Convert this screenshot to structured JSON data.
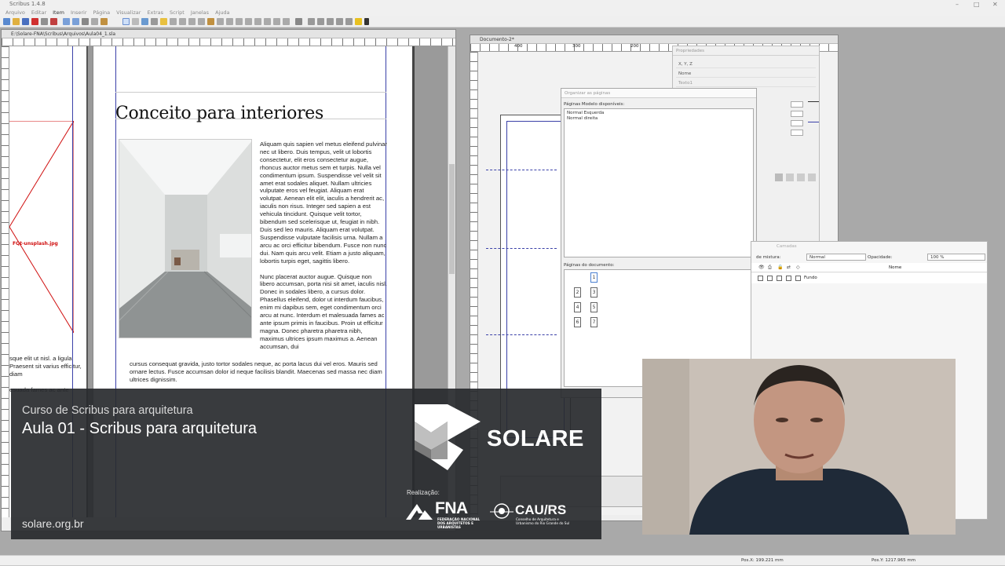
{
  "app": {
    "title": "Scribus 1.4.8",
    "menu": [
      "Arquivo",
      "Editar",
      "Item",
      "Inserir",
      "Página",
      "Visualizar",
      "Extras",
      "Script",
      "Janelas",
      "Ajuda"
    ]
  },
  "window1": {
    "title": "E:\\Solare-FNA\\Scribus\\Arquivos\\Aula04_1.sla",
    "heading": "Conceito para interiores",
    "image_frame_label": "FQt-unsplash.jpg",
    "column_text_1": "Aliquam quis sapien vel metus eleifend pulvinar nec ut libero. Duis tempus, velit ut lobortis consectetur, elit eros consectetur augue, rhoncus auctor metus sem et turpis. Nulla vel condimentum ipsum. Suspendisse vel velit sit amet erat sodales aliquet. Nullam ultricies vulputate eros vel feugiat. Aliquam erat volutpat. Aenean elit elit, iaculis a hendrerit ac, iaculis non risus. Integer sed sapien a est vehicula tincidunt. Quisque velit tortor, bibendum sed scelerisque ut, feugiat in nibh. Duis sed leo mauris. Aliquam erat volutpat. Suspendisse vulputate facilisis urna. Nullam a arcu ac orci efficitur bibendum. Fusce non nunc dui. Nam quis arcu velit. Etiam a justo aliquam, lobortis turpis eget, sagittis libero.",
    "column_text_2": "Nunc placerat auctor augue. Quisque non libero accumsan, porta nisi sit amet, iaculis nisl. Donec in sodales libero, a cursus dolor. Phasellus eleifend, dolor ut interdum faucibus, enim mi dapibus sem, eget condimentum orci arcu at nunc. Interdum et malesuada fames ac ante ipsum primis in faucibus. Proin ut efficitur magna. Donec pharetra pharetra nibh, maximus ultrices ipsum maximus a. Aenean accumsan, dui",
    "bottom_text": "cursus consequat gravida, justo tortor sodales neque, ac porta lacus dui vel eros. Mauris sed ornare lectus. Fusce accumsan dolor id neque facilisis blandit. Maecenas sed massa nec diam ultrices dignissim.",
    "left_text_1": "sque elit ut nisl. a ligula. Praesent sit varius efficitur, diam",
    "left_text_2": "esuada fames ac ante"
  },
  "window2": {
    "title": "Documento-2*",
    "ruler_labels": [
      "400",
      "300",
      "200"
    ]
  },
  "properties": {
    "title": "Propriedades",
    "rows": [
      "X, Y, Z",
      "Nome",
      "Texto1"
    ]
  },
  "organizer": {
    "title": "Organizar as páginas",
    "master_label": "Páginas Modelo disponíveis:",
    "masters": [
      "Normal Esquerda",
      "Normal direita"
    ],
    "doc_label": "Páginas do documento:",
    "pages": [
      "1",
      "2",
      "3",
      "4",
      "5",
      "6",
      "7"
    ]
  },
  "layers": {
    "title": "Camadas",
    "blend_label": "de mistura:",
    "blend_value": "Normal",
    "opacity_label": "Opacidade:",
    "opacity_value": "100 %",
    "name_header": "Nome",
    "layer_name": "Fundo"
  },
  "status": {
    "posx": "Pos.X: 199.221 mm",
    "posy": "Pos.Y: 1217.965 mm"
  },
  "overlay": {
    "course": "Curso de Scribus para arquitetura",
    "lesson": "Aula 01 - Scribus para arquitetura",
    "site": "solare.org.br",
    "brand": "SOLARE",
    "realizacao": "Realização:",
    "fna": "FNA",
    "fna_sub": "FEDERAÇÃO NACIONAL DOS ARQUITETOS E URBANISTAS",
    "cau": "CAU/RS",
    "cau_sub": "Conselho de Arquitetura e Urbanismo do Rio Grande do Sul"
  },
  "colors": {
    "overlay_bg": "#2a2c30",
    "frame_red": "#d01010",
    "guide_blue": "#3a40a8"
  }
}
